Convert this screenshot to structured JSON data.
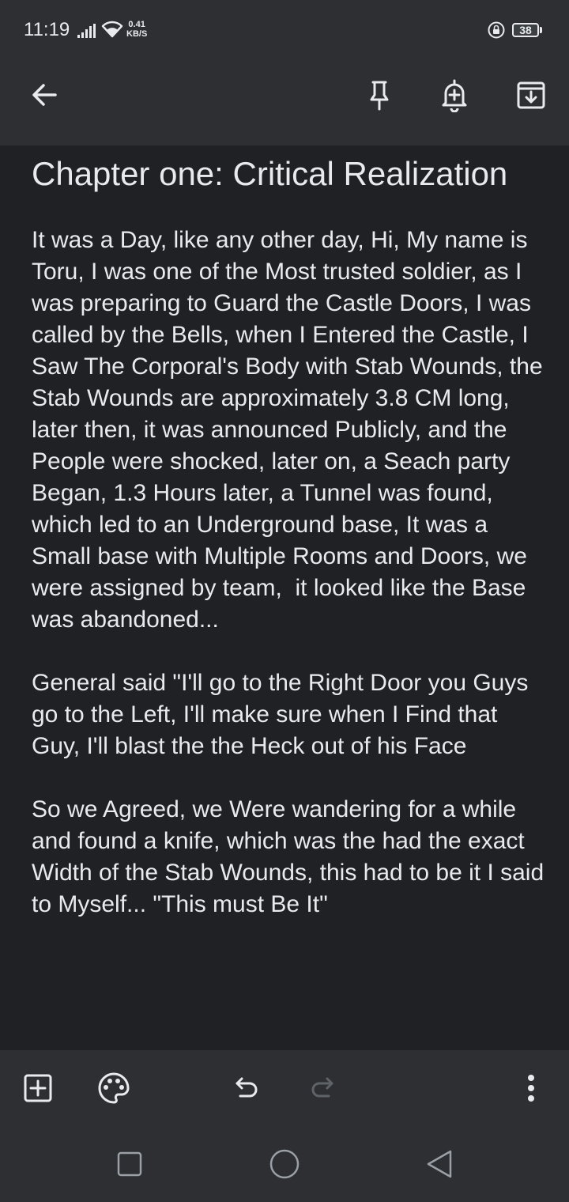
{
  "status": {
    "time": "11:19",
    "net_speed_value": "0.41",
    "net_speed_unit": "KB/S",
    "battery": "38"
  },
  "toolbar": {
    "back_icon": "arrow-left-icon",
    "pin_icon": "pin-icon",
    "reminder_icon": "bell-plus-icon",
    "archive_icon": "archive-icon"
  },
  "note": {
    "title": "Chapter one: Critical Realization",
    "body": "It was a Day, like any other day, Hi, My name is Toru, I was one of the Most trusted soldier, as I was preparing to Guard the Castle Doors, I was called by the Bells, when I Entered the Castle, I Saw The Corporal's Body with Stab Wounds, the Stab Wounds are approximately 3.8 CM long, later then, it was announced Publicly, and the People were shocked, later on, a Seach party Began, 1.3 Hours later, a Tunnel was found, which led to an Underground base, It was a Small base with Multiple Rooms and Doors, we were assigned by team,  it looked like the Base was abandoned...\n\nGeneral said \"I'll go to the Right Door you Guys go to the Left, I'll make sure when I Find that Guy, I'll blast the the Heck out of his Face\n\nSo we Agreed, we Were wandering for a while and found a knife, which was the had the exact Width of the Stab Wounds, this had to be it I said to Myself... \"This must Be It\""
  },
  "bottom_toolbar": {
    "add_icon": "add-box-icon",
    "palette_icon": "palette-icon",
    "undo_icon": "undo-icon",
    "redo_icon": "redo-icon",
    "more_icon": "more-vert-icon"
  },
  "navigation": {
    "recents_icon": "square-icon",
    "home_icon": "circle-icon",
    "back_icon": "triangle-back-icon"
  },
  "colors": {
    "background": "#202124",
    "bar": "#2d2f33",
    "text": "#e8eaed",
    "disabled": "#5f6368"
  }
}
